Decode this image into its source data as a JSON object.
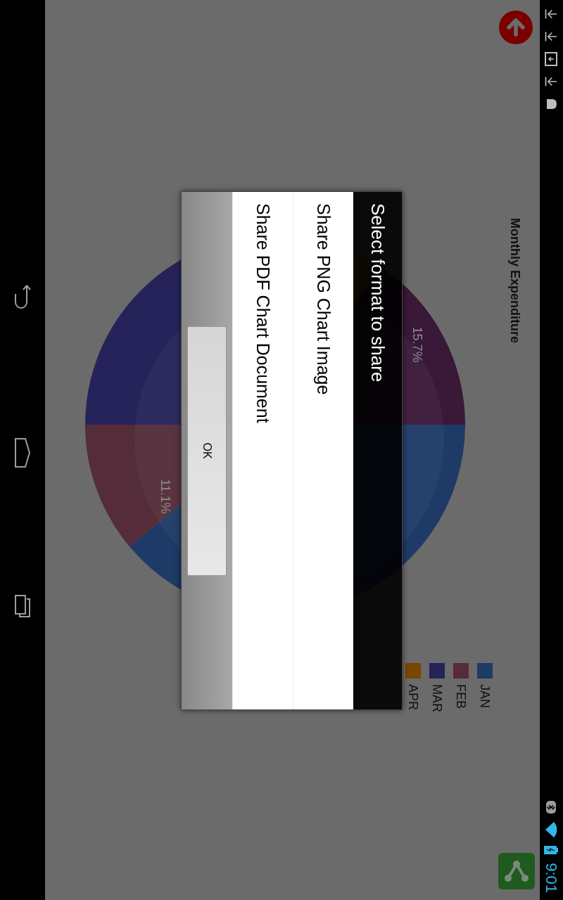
{
  "status_bar": {
    "time": "9:01"
  },
  "chart": {
    "title": "Monthly Expenditure",
    "slice_labels": [
      "15.7%",
      "11.1%"
    ],
    "legend": [
      {
        "label": "JAN",
        "color": "#1e3a66"
      },
      {
        "label": "FEB",
        "color": "#552c3a"
      },
      {
        "label": "MAR",
        "color": "#25235a"
      },
      {
        "label": "APR",
        "color": "#7a4500"
      }
    ]
  },
  "dialog": {
    "title": "Select format to share",
    "options": [
      "Share PNG Chart Image",
      "Share PDF Chart Document"
    ],
    "button": "OK"
  }
}
